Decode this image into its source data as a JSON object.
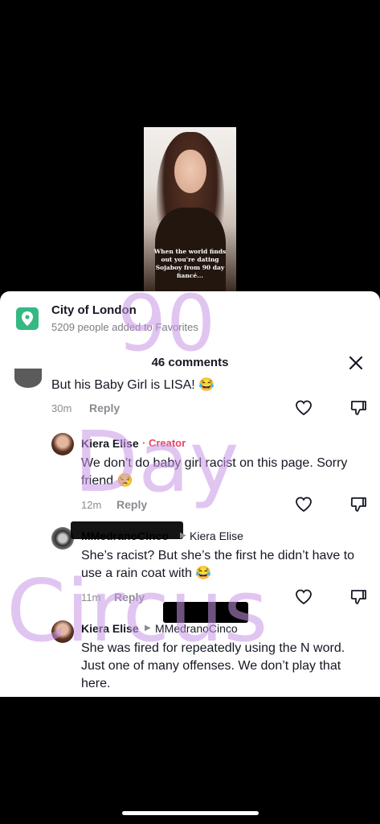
{
  "video": {
    "caption": "When the world finds out you're dating Sojaboy from 90 day fiancé..."
  },
  "location": {
    "title": "City of London",
    "subtitle": "5209 people added to Favorites"
  },
  "header": {
    "comments_count": "46 comments"
  },
  "comments": [
    {
      "text": "But his Baby Girl is LISA! 😂",
      "time": "30m",
      "reply": "Reply"
    },
    {
      "author": "Kiera Elise",
      "badge": "· Creator",
      "text": "We don’t do baby girl racist on this page. Sorry friend 😒",
      "time": "12m",
      "reply": "Reply"
    },
    {
      "author": "MMedranoCinco",
      "reply_to": "Kiera Elise",
      "text": "She’s racist? But she’s the first he didn’t have to use a rain coat with 😂",
      "time": "11m",
      "reply": "Reply"
    },
    {
      "author": "Kiera Elise",
      "reply_to": "MMedranoCinco",
      "text": "She was fired for repeatedly using the N word. Just one of many offenses. We don’t play that here."
    }
  ],
  "watermark": {
    "line1": "90",
    "line2": "Day",
    "line3": "Circus"
  },
  "colors": {
    "accent_creator": "#e8455f",
    "location_icon": "#35b983",
    "watermark": "#c896e6"
  }
}
